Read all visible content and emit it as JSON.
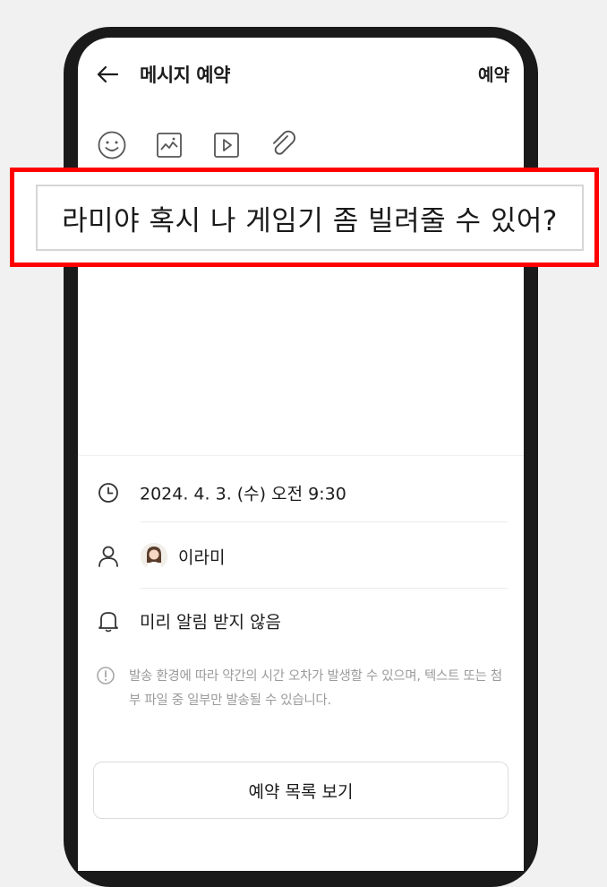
{
  "header": {
    "back_icon": "arrow-left-icon",
    "title": "메시지 예약",
    "schedule_label": "예약"
  },
  "toolbar": {
    "icons": [
      "emoji-icon",
      "image-icon",
      "video-icon",
      "attachment-icon"
    ]
  },
  "message": {
    "text": "라미야 혹시 나 게임기 좀 빌려줄 수 있어?"
  },
  "schedule": {
    "icon": "clock-icon",
    "datetime": "2024. 4. 3. (수) 오전 9:30"
  },
  "recipient": {
    "icon": "person-icon",
    "name": "이라미"
  },
  "alarm": {
    "icon": "bell-icon",
    "label": "미리 알림 받지 않음"
  },
  "notice": {
    "icon": "info-icon",
    "text": "발송 환경에 따라 약간의 시간 오차가 발생할 수 있으며, 텍스트 또는 첨부 파일 중 일부만 발송될 수 있습니다."
  },
  "footer": {
    "list_button_label": "예약 목록 보기"
  },
  "colors": {
    "highlight": "#ff0000",
    "frame": "#1a1a1a",
    "notice_text": "#9b9b9b"
  }
}
